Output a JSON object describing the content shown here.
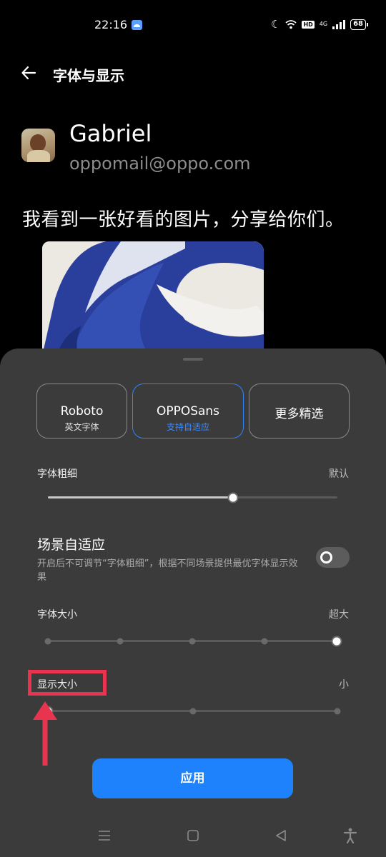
{
  "status_bar": {
    "time": "22:16",
    "hd_label": "HD",
    "network_label": "4G",
    "battery_level": "68"
  },
  "header": {
    "title": "字体与显示",
    "back_icon": "arrow-left-icon"
  },
  "preview": {
    "user_name": "Gabriel",
    "user_email": "oppomail@oppo.com",
    "message": "我看到一张好看的图片，分享给你们。"
  },
  "font_cards": [
    {
      "name": "Roboto",
      "subtitle": "英文字体",
      "selected": false
    },
    {
      "name": "OPPOSans",
      "subtitle": "支持自适应",
      "selected": true
    },
    {
      "name": "更多精选",
      "selected": false
    }
  ],
  "font_weight": {
    "label": "字体粗细",
    "value_label": "默认",
    "level": 0.64
  },
  "scene_adapt": {
    "title": "场景自适应",
    "description": "开启后不可调节“字体粗细”，根据不同场景提供最优字体显示效果",
    "enabled": false
  },
  "font_size": {
    "label": "字体大小",
    "value_label": "超大",
    "steps": 5,
    "selected_step": 5
  },
  "display_size": {
    "label": "显示大小",
    "value_label": "小",
    "steps": 3,
    "selected_step": 1
  },
  "apply_button": {
    "label": "应用"
  },
  "annotation": {
    "color": "#e8344e"
  },
  "colors": {
    "accent": "#1f82fd",
    "sheet_bg": "#3b3b3b"
  },
  "nav_bar": {
    "menu_icon": "menu-icon",
    "home_icon": "home-square-icon",
    "back_icon": "back-triangle-icon",
    "accessibility_icon": "accessibility-icon"
  }
}
